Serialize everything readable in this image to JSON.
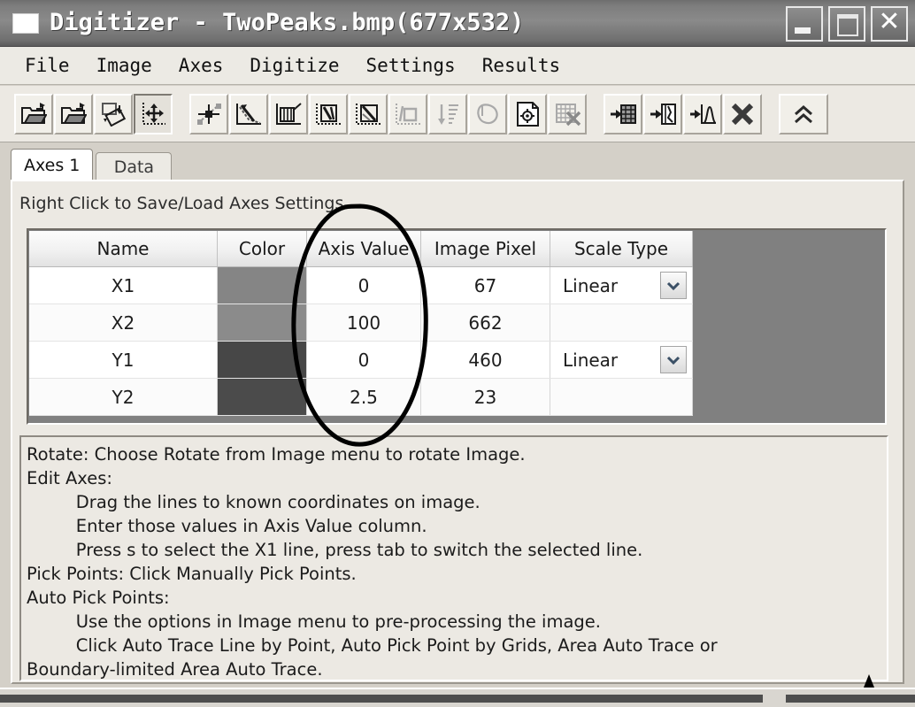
{
  "window": {
    "title": "Digitizer  -  TwoPeaks.bmp(677x532)",
    "app_icon": "document-icon",
    "minimize_label": "",
    "maximize_label": "",
    "close_label": "✕"
  },
  "menu": {
    "items": [
      {
        "label": "File"
      },
      {
        "label": "Image"
      },
      {
        "label": "Axes"
      },
      {
        "label": "Digitize"
      },
      {
        "label": "Settings"
      },
      {
        "label": "Results"
      }
    ]
  },
  "toolbar": {
    "groups": [
      {
        "buttons": [
          {
            "name": "open-image-button",
            "icon": "open-folder-icon",
            "enabled": true,
            "pressed": false
          },
          {
            "name": "open-project-button",
            "icon": "open-folder-icon",
            "enabled": true,
            "pressed": false
          },
          {
            "name": "rotate-image-button",
            "icon": "rotate-image-icon",
            "enabled": true,
            "pressed": false
          },
          {
            "name": "move-axes-button",
            "icon": "move-axes-icon",
            "enabled": true,
            "pressed": true
          }
        ]
      },
      {
        "buttons": [
          {
            "name": "pick-points-button",
            "icon": "crosshair-point-icon",
            "enabled": true,
            "pressed": false
          },
          {
            "name": "auto-trace-line-button",
            "icon": "trace-line-icon",
            "enabled": true,
            "pressed": false
          },
          {
            "name": "pick-by-grids-button",
            "icon": "grid-pick-icon",
            "enabled": true,
            "pressed": false
          },
          {
            "name": "area-auto-trace-button",
            "icon": "area-trace-icon",
            "enabled": true,
            "pressed": false
          },
          {
            "name": "boundary-area-trace-button",
            "icon": "boundary-trace-icon",
            "enabled": true,
            "pressed": false
          },
          {
            "name": "polygon-select-button",
            "icon": "polygon-select-icon",
            "enabled": false,
            "pressed": false
          },
          {
            "name": "sort-points-button",
            "icon": "sort-descending-icon",
            "enabled": false,
            "pressed": false
          },
          {
            "name": "lasso-select-button",
            "icon": "lasso-icon",
            "enabled": false,
            "pressed": false
          },
          {
            "name": "new-point-set-button",
            "icon": "new-point-page-icon",
            "enabled": true,
            "pressed": false
          },
          {
            "name": "clear-grid-button",
            "icon": "clear-grid-icon",
            "enabled": false,
            "pressed": false
          }
        ]
      },
      {
        "buttons": [
          {
            "name": "export-to-table-button",
            "icon": "export-table-icon",
            "enabled": true,
            "pressed": false
          },
          {
            "name": "export-to-plot-button",
            "icon": "export-plot-icon",
            "enabled": true,
            "pressed": false
          },
          {
            "name": "export-to-curve-button",
            "icon": "export-curve-icon",
            "enabled": true,
            "pressed": false
          },
          {
            "name": "delete-button",
            "icon": "close-x-icon",
            "enabled": true,
            "pressed": false
          }
        ]
      },
      {
        "buttons": [
          {
            "name": "collapse-toolbar-button",
            "icon": "double-chevron-up-icon",
            "enabled": true,
            "pressed": false
          }
        ]
      }
    ]
  },
  "tabs": [
    {
      "label": "Axes 1",
      "active": true
    },
    {
      "label": "Data",
      "active": false
    }
  ],
  "panel": {
    "hint": "Right Click to Save/Load Axes Settings."
  },
  "axes_table": {
    "columns": [
      "Name",
      "Color",
      "Axis Value",
      "Image Pixel",
      "Scale Type"
    ],
    "rows": [
      {
        "name": "X1",
        "color": "#858585",
        "axis_value": "0",
        "image_pixel": "67",
        "scale_type": "Linear",
        "has_scale": true
      },
      {
        "name": "X2",
        "color": "#8b8b8b",
        "axis_value": "100",
        "image_pixel": "662",
        "scale_type": "",
        "has_scale": false
      },
      {
        "name": "Y1",
        "color": "#474747",
        "axis_value": "0",
        "image_pixel": "460",
        "scale_type": "Linear",
        "has_scale": true
      },
      {
        "name": "Y2",
        "color": "#4b4b4b",
        "axis_value": "2.5",
        "image_pixel": "23",
        "scale_type": "",
        "has_scale": false
      }
    ]
  },
  "instructions": {
    "lines": [
      "Rotate: Choose Rotate from Image menu to rotate Image.",
      "Edit Axes:",
      "         Drag the lines to known coordinates on image.",
      "         Enter those values in Axis Value column.",
      "         Press s to select the X1 line, press tab to switch the selected line.",
      "Pick Points: Click Manually Pick Points.",
      "Auto Pick Points:",
      "         Use the options in Image menu to pre-processing the image.",
      "         Click Auto Trace Line by Point, Auto Pick Point by Grids, Area Auto Trace or",
      "Boundary-limited Area Auto Trace."
    ]
  },
  "annotations": {
    "ellipse_target": "axis-value-column",
    "arrow_target": "instructions-panel-bottom-right",
    "ink_color": "#000000"
  }
}
